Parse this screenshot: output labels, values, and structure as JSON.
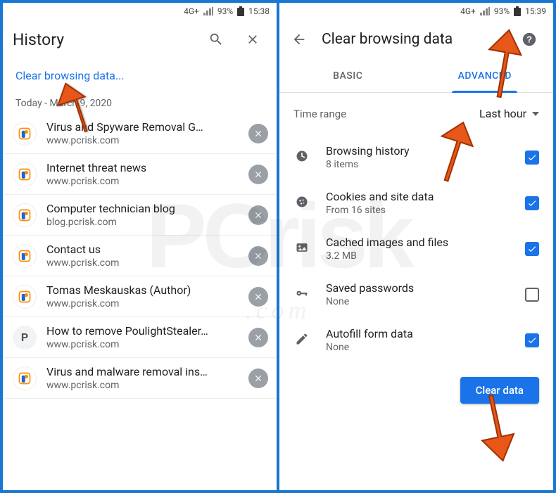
{
  "statusbar": {
    "network": "4G+",
    "battery_pct": "93%",
    "time_left": "15:38",
    "time_right": "15:39"
  },
  "left": {
    "title": "History",
    "clear_link": "Clear browsing data...",
    "date_header": "Today - March 9, 2020",
    "items": [
      {
        "title": "Virus and Spyware Removal G…",
        "sub": "www.pcrisk.com",
        "icon": "pcrisk"
      },
      {
        "title": "Internet threat news",
        "sub": "www.pcrisk.com",
        "icon": "pcrisk"
      },
      {
        "title": "Computer technician blog",
        "sub": "blog.pcrisk.com",
        "icon": "pcrisk"
      },
      {
        "title": "Contact us",
        "sub": "www.pcrisk.com",
        "icon": "pcrisk"
      },
      {
        "title": "Tomas Meskauskas (Author)",
        "sub": "www.pcrisk.com",
        "icon": "pcrisk"
      },
      {
        "title": "How to remove PoulightStealer…",
        "sub": "www.pcrisk.com",
        "icon": "letter-p"
      },
      {
        "title": "Virus and malware removal ins…",
        "sub": "www.pcrisk.com",
        "icon": "pcrisk"
      }
    ]
  },
  "right": {
    "title": "Clear browsing data",
    "tabs": {
      "basic": "BASIC",
      "advanced": "ADVANCED"
    },
    "time_range_label": "Time range",
    "time_range_value": "Last hour",
    "items": [
      {
        "icon": "clock",
        "title": "Browsing history",
        "sub": "8 items",
        "checked": true
      },
      {
        "icon": "cookie",
        "title": "Cookies and site data",
        "sub": "From 16 sites",
        "checked": true
      },
      {
        "icon": "image",
        "title": "Cached images and files",
        "sub": "3.2 MB",
        "checked": true
      },
      {
        "icon": "key",
        "title": "Saved passwords",
        "sub": "None",
        "checked": false
      },
      {
        "icon": "pencil",
        "title": "Autofill form data",
        "sub": "None",
        "checked": true
      }
    ],
    "button": "Clear data"
  },
  "watermark": {
    "big": "PCrisk",
    "sub": ".com"
  }
}
